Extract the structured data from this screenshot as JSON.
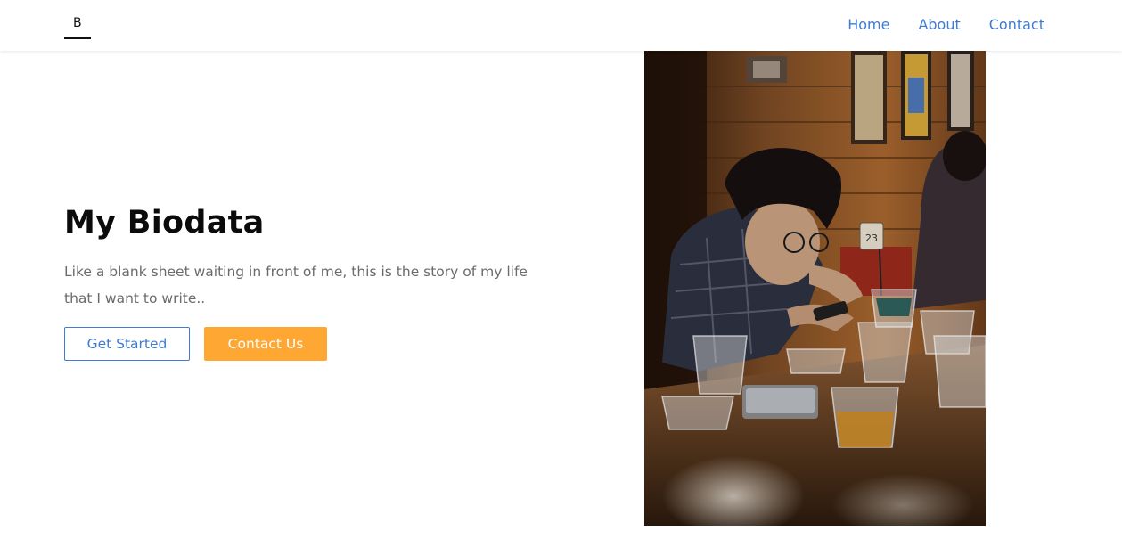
{
  "navbar": {
    "logo_letter": "B",
    "links": [
      {
        "label": "Home"
      },
      {
        "label": "About"
      },
      {
        "label": "Contact"
      }
    ]
  },
  "hero": {
    "title": "My Biodata",
    "description": "Like a blank sheet waiting in front of me, this is the story of my life that I want to write..",
    "buttons": {
      "get_started": "Get Started",
      "contact_us": "Contact Us"
    },
    "photo_sign_text": "23"
  },
  "colors": {
    "link_blue": "#3f7bd1",
    "accent_orange": "#ffa733",
    "title": "#0b0b0b",
    "body_text": "#6b6b6b"
  }
}
